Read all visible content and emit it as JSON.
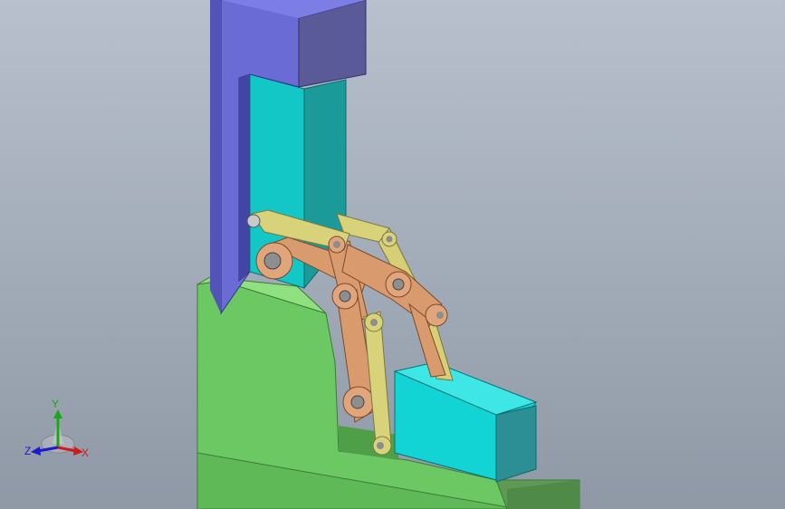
{
  "viewport": {
    "background_top": "#b7c0cc",
    "background_bottom": "#8f99a6"
  },
  "model": {
    "parts": [
      {
        "name": "upper-slide-block",
        "color": "#6a6ad8"
      },
      {
        "name": "cyan-guide-column",
        "color": "#10c4c4"
      },
      {
        "name": "green-base",
        "color": "#7ed46e"
      },
      {
        "name": "lower-slider",
        "color": "#10d8d8"
      },
      {
        "name": "copper-links",
        "color": "#d99b6e"
      },
      {
        "name": "yellow-links",
        "color": "#d8d27a"
      }
    ]
  },
  "triad": {
    "y_label": "Y",
    "z_label": "Z",
    "x_label": "X",
    "y_color": "#1aa81a",
    "x_color": "#d01a1a",
    "z_color": "#1a1ad0"
  }
}
